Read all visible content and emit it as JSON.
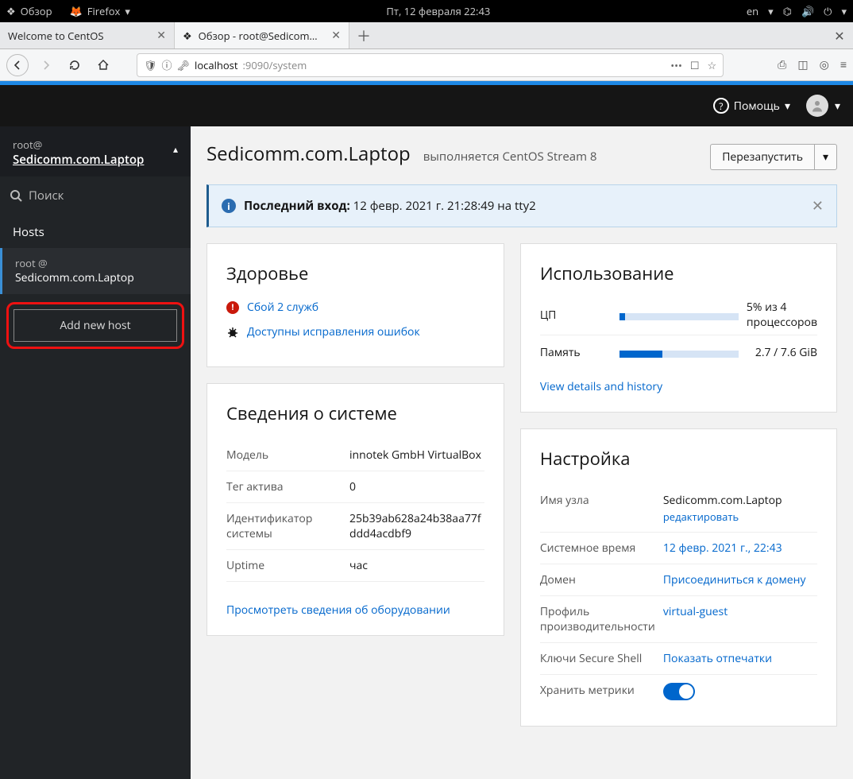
{
  "gnome": {
    "app_title": "Обзор",
    "browser_menu": "Firefox",
    "datetime": "Пт, 12 февраля  22:43",
    "lang": "en"
  },
  "tabs": {
    "tab1": "Welcome to CentOS",
    "tab2": "Обзор - root@Sedicomm…",
    "url_host": "localhost",
    "url_path": ":9090/system"
  },
  "cockpit": {
    "help": "Помощь",
    "sidebar_user": "root@",
    "sidebar_host": "Sedicomm.com.Laptop",
    "search_placeholder": "Поиск",
    "hosts_label": "Hosts",
    "hostitem_user": "root @",
    "hostitem_host": "Sedicomm.com.Laptop",
    "add_host": "Add new host"
  },
  "titlebar": {
    "hostname": "Sedicomm.com.Laptop",
    "status": "выполняется",
    "os": "CentOS Stream 8",
    "restart": "Перезапустить"
  },
  "alert": {
    "label": "Последний вход:",
    "value": "12 февр. 2021 г. 21:28:49 на tty2"
  },
  "health": {
    "title": "Здоровье",
    "fail_link": "Сбой 2 служб",
    "bug_link": "Доступны исправления ошибок"
  },
  "usage": {
    "title": "Использование",
    "cpu_label": "ЦП",
    "cpu_value": "5%",
    "cpu_of": "из 4 процессоров",
    "cpu_pct": 5,
    "mem_label": "Память",
    "mem_value": "2.7 / 7.6 GiB",
    "mem_pct": 36,
    "view_link": "View details and history"
  },
  "sysinfo": {
    "title": "Сведения о системе",
    "model_lbl": "Модель",
    "model_val": "innotek GmbH VirtualBox",
    "tag_lbl": "Тег актива",
    "tag_val": "0",
    "id_lbl": "Идентификатор системы",
    "id_val": "25b39ab628a24b38aa77fddd4acdbf9",
    "uptime_lbl": "Uptime",
    "uptime_val": "час",
    "hw_link": "Просмотреть сведения об оборудовании"
  },
  "config": {
    "title": "Настройка",
    "host_lbl": "Имя узла",
    "host_val": "Sedicomm.com.Laptop",
    "host_edit": "редактировать",
    "time_lbl": "Системное время",
    "time_val": "12 февр. 2021 г., 22:43",
    "domain_lbl": "Домен",
    "domain_val": "Присоединиться к домену",
    "perf_lbl": "Профиль производительности",
    "perf_val": "virtual-guest",
    "ssh_lbl": "Ключи Secure Shell",
    "ssh_val": "Показать отпечатки",
    "metrics_lbl": "Хранить метрики"
  }
}
